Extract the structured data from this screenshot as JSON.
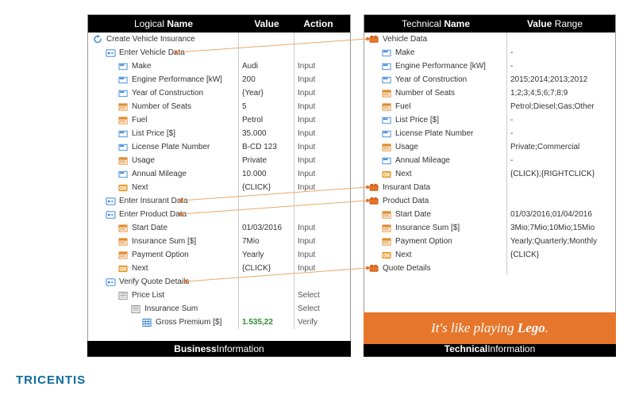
{
  "left": {
    "header": {
      "name_prefix": "Logical ",
      "name_bold": "Name",
      "value": "Value",
      "action": "Action"
    },
    "footer": {
      "bold": "Business",
      "rest": " Information"
    },
    "rows": [
      {
        "icon": "refresh",
        "indent": 1,
        "label": "Create Vehicle Insurance",
        "value": "",
        "action": ""
      },
      {
        "icon": "module",
        "indent": 2,
        "label": "Enter Vehicle Data",
        "value": "",
        "action": ""
      },
      {
        "icon": "field",
        "indent": 3,
        "label": "Make",
        "value": "Audi",
        "action": "Input"
      },
      {
        "icon": "field",
        "indent": 3,
        "label": "Engine Performance [kW]",
        "value": "200",
        "action": "Input"
      },
      {
        "icon": "field",
        "indent": 3,
        "label": "Year of Construction",
        "value": "{Year}",
        "action": "Input"
      },
      {
        "icon": "combo",
        "indent": 3,
        "label": "Number of Seats",
        "value": "5",
        "action": "Input"
      },
      {
        "icon": "combo",
        "indent": 3,
        "label": "Fuel",
        "value": "Petrol",
        "action": "Input"
      },
      {
        "icon": "field",
        "indent": 3,
        "label": "List Price [$]",
        "value": "35.000",
        "action": "Input"
      },
      {
        "icon": "field",
        "indent": 3,
        "label": "License Plate Number",
        "value": "B-CD 123",
        "action": "Input"
      },
      {
        "icon": "combo",
        "indent": 3,
        "label": "Usage",
        "value": "Private",
        "action": "Input"
      },
      {
        "icon": "field",
        "indent": 3,
        "label": "Annual Mileage",
        "value": "10.000",
        "action": "Input"
      },
      {
        "icon": "ok",
        "indent": 3,
        "label": "Next",
        "value": "{CLICK}",
        "action": "Input"
      },
      {
        "icon": "module",
        "indent": 2,
        "label": "Enter Insurant Data",
        "value": "",
        "action": ""
      },
      {
        "icon": "module",
        "indent": 2,
        "label": "Enter Product Data",
        "value": "",
        "action": ""
      },
      {
        "icon": "combo",
        "indent": 3,
        "label": "Start Date",
        "value": "01/03/2016",
        "action": "Input"
      },
      {
        "icon": "combo",
        "indent": 3,
        "label": "Insurance Sum [$]",
        "value": "7Mio",
        "action": "Input"
      },
      {
        "icon": "combo",
        "indent": 3,
        "label": "Payment Option",
        "value": "Yearly",
        "action": "Input"
      },
      {
        "icon": "ok",
        "indent": 3,
        "label": "Next",
        "value": "{CLICK}",
        "action": "Input"
      },
      {
        "icon": "module",
        "indent": 2,
        "label": "Verify Quote Details",
        "value": "",
        "action": ""
      },
      {
        "icon": "list",
        "indent": 3,
        "label": "Price List",
        "value": "",
        "action": "Select"
      },
      {
        "icon": "list",
        "indent": 4,
        "label": "Insurance Sum",
        "value": "",
        "action": "Select"
      },
      {
        "icon": "grid",
        "indent": 5,
        "label": "Gross Premium [$]",
        "value": "1.535,22",
        "action": "Verify",
        "green": true
      }
    ]
  },
  "right": {
    "header": {
      "name_prefix": "Technical ",
      "name_bold": "Name",
      "value_bold": "Value",
      "value_rest": " Range"
    },
    "footer": {
      "bold": "Technical",
      "rest": " Information"
    },
    "rows": [
      {
        "icon": "brick",
        "indent": 1,
        "label": "Vehicle Data",
        "value": ""
      },
      {
        "icon": "field",
        "indent": 2,
        "label": "Make",
        "value": "-"
      },
      {
        "icon": "field",
        "indent": 2,
        "label": "Engine Performance [kW]",
        "value": "-"
      },
      {
        "icon": "field",
        "indent": 2,
        "label": "Year of Construction",
        "value": "2015;2014;2013;2012"
      },
      {
        "icon": "combo",
        "indent": 2,
        "label": "Number of Seats",
        "value": "1;2;3;4;5;6;7;8;9"
      },
      {
        "icon": "combo",
        "indent": 2,
        "label": "Fuel",
        "value": "Petrol;Diesel;Gas;Other"
      },
      {
        "icon": "field",
        "indent": 2,
        "label": "List Price [$]",
        "value": "-"
      },
      {
        "icon": "field",
        "indent": 2,
        "label": "License Plate Number",
        "value": "-"
      },
      {
        "icon": "combo",
        "indent": 2,
        "label": "Usage",
        "value": "Private;Commercial"
      },
      {
        "icon": "field",
        "indent": 2,
        "label": "Annual Mileage",
        "value": "-"
      },
      {
        "icon": "ok",
        "indent": 2,
        "label": "Next",
        "value": "{CLICK};{RIGHTCLICK}"
      },
      {
        "icon": "brick",
        "indent": 1,
        "label": "Insurant Data",
        "value": ""
      },
      {
        "icon": "brick",
        "indent": 1,
        "label": "Product Data",
        "value": ""
      },
      {
        "icon": "combo",
        "indent": 2,
        "label": "Start Date",
        "value": "01/03/2016;01/04/2016"
      },
      {
        "icon": "combo",
        "indent": 2,
        "label": "Insurance Sum [$]",
        "value": "3Mio;7Mio;10Mio;15Mio"
      },
      {
        "icon": "combo",
        "indent": 2,
        "label": "Payment Option",
        "value": "Yearly;Quarterly;Monthly"
      },
      {
        "icon": "ok",
        "indent": 2,
        "label": "Next",
        "value": "{CLICK}"
      },
      {
        "icon": "brick",
        "indent": 1,
        "label": "Quote Details",
        "value": ""
      }
    ]
  },
  "callout": {
    "prefix": "It's like playing ",
    "bold": "Lego",
    "suffix": "."
  },
  "brand": "TRICENTIS"
}
